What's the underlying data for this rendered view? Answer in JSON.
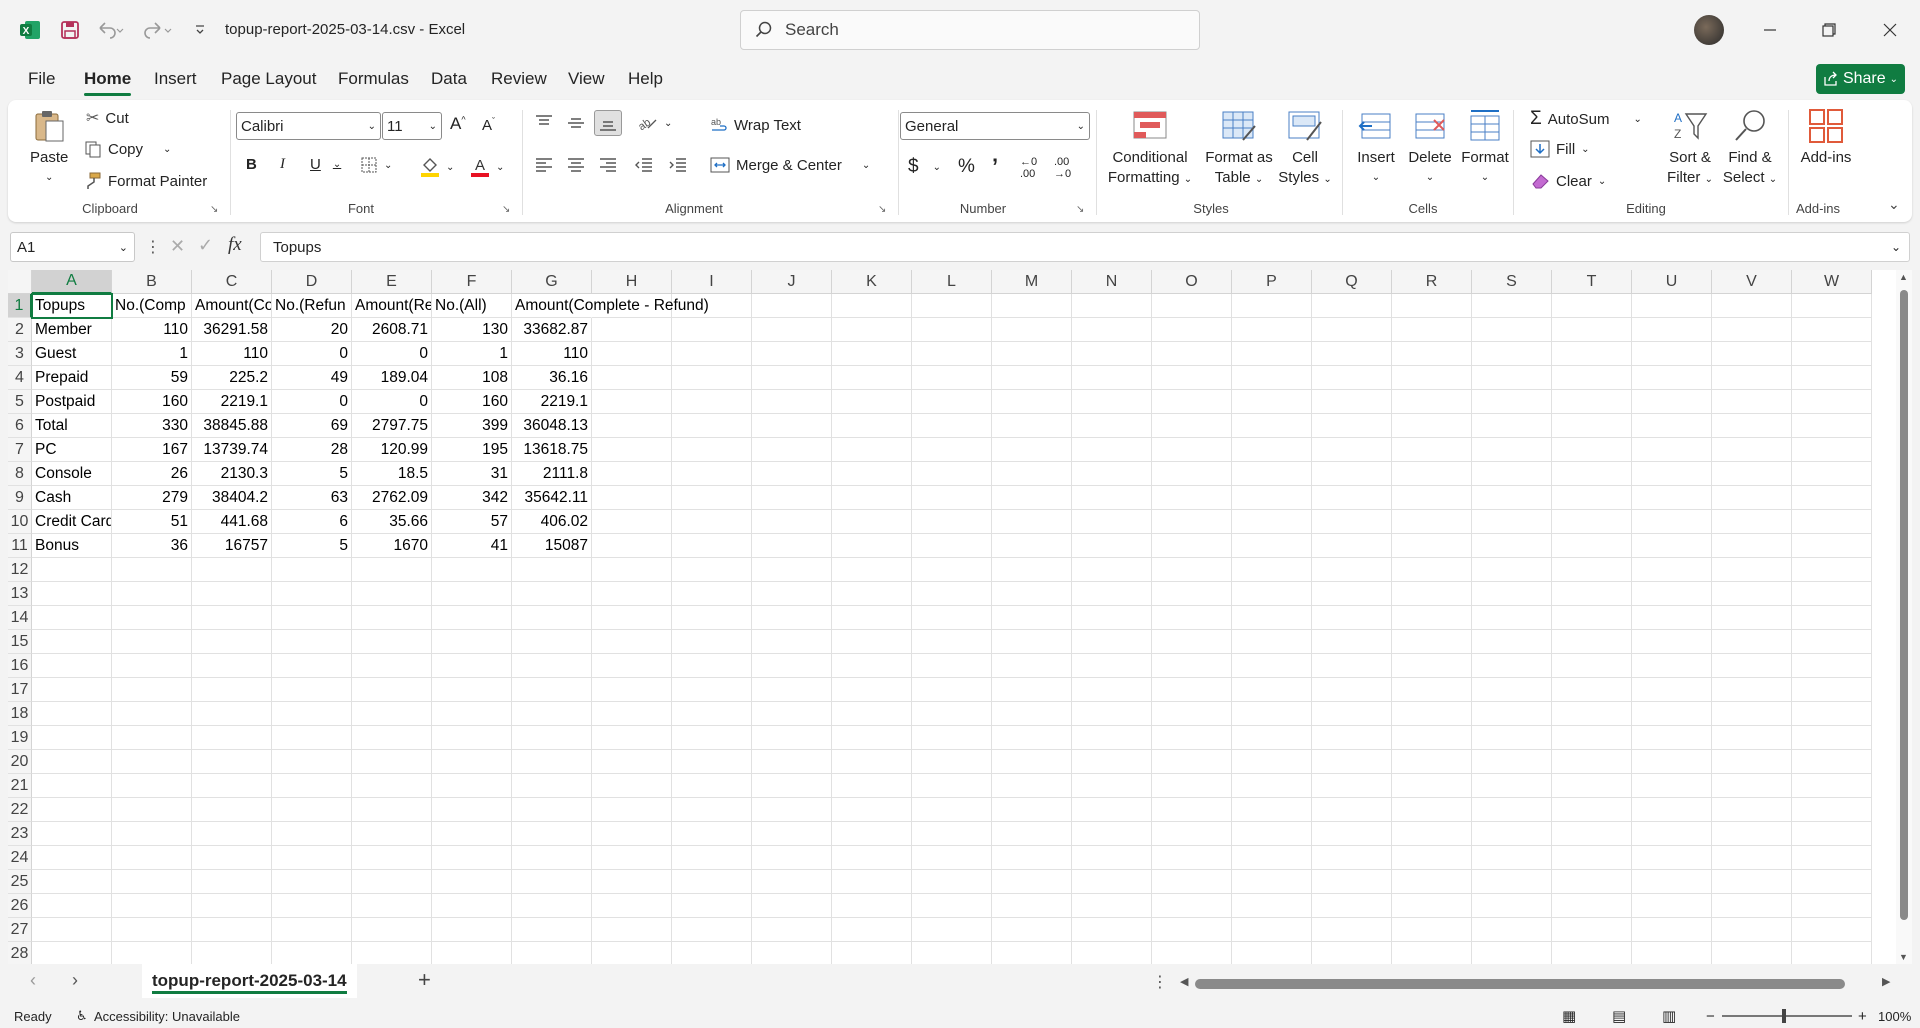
{
  "window": {
    "title": "topup-report-2025-03-14.csv  -  Excel",
    "search_placeholder": "Search"
  },
  "menu_tabs": [
    "File",
    "Home",
    "Insert",
    "Page Layout",
    "Formulas",
    "Data",
    "Review",
    "View",
    "Help"
  ],
  "share_label": "Share",
  "ribbon": {
    "clipboard": {
      "label": "Clipboard",
      "paste": "Paste",
      "cut": "Cut",
      "copy": "Copy",
      "format_painter": "Format Painter"
    },
    "font": {
      "label": "Font",
      "name": "Calibri",
      "size": "11",
      "bold": "B",
      "italic": "I",
      "underline": "U"
    },
    "alignment": {
      "label": "Alignment",
      "wrap_text": "Wrap Text",
      "merge_center": "Merge & Center"
    },
    "number": {
      "label": "Number",
      "format": "General",
      "currency": "$",
      "percent": "%",
      "comma": "’"
    },
    "styles": {
      "label": "Styles",
      "conditional": [
        "Conditional",
        "Formatting"
      ],
      "format_table": [
        "Format as",
        "Table"
      ],
      "cell_styles": [
        "Cell",
        "Styles"
      ]
    },
    "cells": {
      "label": "Cells",
      "insert": "Insert",
      "delete": "Delete",
      "format": "Format"
    },
    "editing": {
      "label": "Editing",
      "autosum": "AutoSum",
      "fill": "Fill",
      "clear": "Clear",
      "sort_filter": [
        "Sort &",
        "Filter"
      ],
      "find_select": [
        "Find &",
        "Select"
      ]
    },
    "addins": {
      "label": "Add-ins",
      "button": "Add-ins"
    }
  },
  "formula_bar": {
    "name_box": "A1",
    "fx": "fx",
    "value": "Topups"
  },
  "columns": [
    "A",
    "B",
    "C",
    "D",
    "E",
    "F",
    "G",
    "H",
    "I",
    "J",
    "K",
    "L",
    "M",
    "N",
    "O",
    "P",
    "Q",
    "R",
    "S",
    "T",
    "U",
    "V",
    "W"
  ],
  "row_count": 28,
  "rows": [
    [
      "Topups",
      "No.(Comp",
      "Amount(Co",
      "No.(Refun",
      "Amount(Re",
      "No.(All)",
      "Amount(Complete - Refund)"
    ],
    [
      "Member",
      "110",
      "36291.58",
      "20",
      "2608.71",
      "130",
      "33682.87"
    ],
    [
      "Guest",
      "1",
      "110",
      "0",
      "0",
      "1",
      "110"
    ],
    [
      "Prepaid",
      "59",
      "225.2",
      "49",
      "189.04",
      "108",
      "36.16"
    ],
    [
      "Postpaid",
      "160",
      "2219.1",
      "0",
      "0",
      "160",
      "2219.1"
    ],
    [
      "Total",
      "330",
      "38845.88",
      "69",
      "2797.75",
      "399",
      "36048.13"
    ],
    [
      "PC",
      "167",
      "13739.74",
      "28",
      "120.99",
      "195",
      "13618.75"
    ],
    [
      "Console",
      "26",
      "2130.3",
      "5",
      "18.5",
      "31",
      "2111.8"
    ],
    [
      "Cash",
      "279",
      "38404.2",
      "63",
      "2762.09",
      "342",
      "35642.11"
    ],
    [
      "Credit Card",
      "51",
      "441.68",
      "6",
      "35.66",
      "57",
      "406.02"
    ],
    [
      "Bonus",
      "36",
      "16757",
      "5",
      "1670",
      "41",
      "15087"
    ]
  ],
  "sheet": {
    "tab": "topup-report-2025-03-14",
    "add": "+"
  },
  "status": {
    "ready": "Ready",
    "accessibility": "Accessibility: Unavailable",
    "zoom": "100%"
  },
  "colors": {
    "accent": "#107c41"
  }
}
